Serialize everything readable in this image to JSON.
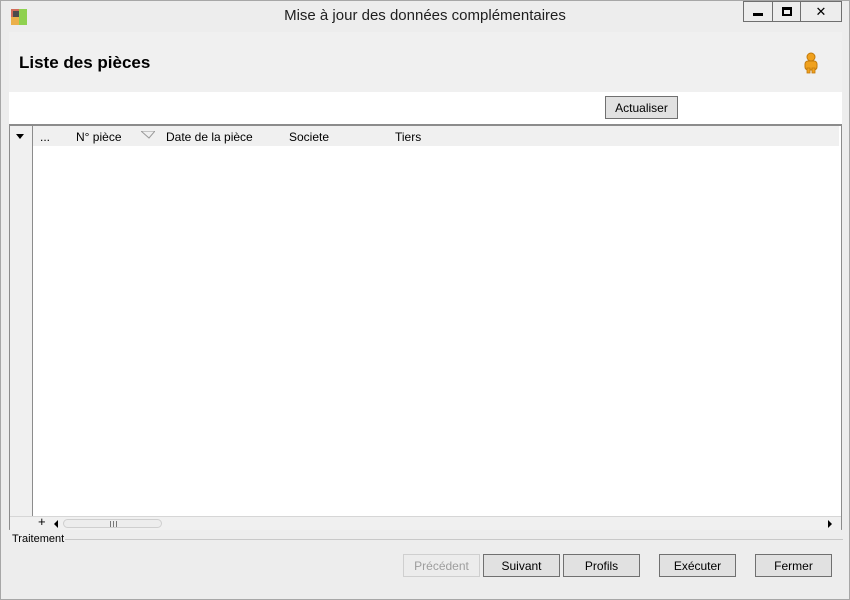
{
  "window": {
    "title": "Mise à jour des données complémentaires",
    "controls": {
      "minimize": "minimize",
      "maximize": "maximize",
      "close": "close"
    }
  },
  "header": {
    "title": "Liste des pièces",
    "user_icon": "user-icon"
  },
  "toolbar": {
    "refresh_label": "Actualiser"
  },
  "grid": {
    "columns": [
      "...",
      "N° pièce",
      "Date de la pièce",
      "Societe",
      "Tiers"
    ],
    "sorted_column": "Date de la pièce",
    "rows": [],
    "footer": {
      "add_symbol": "+",
      "scroll_grip": "|||"
    }
  },
  "section": {
    "label": "Traitement"
  },
  "buttons": {
    "previous": "Précédent",
    "next": "Suivant",
    "profiles": "Profils",
    "execute": "Exécuter",
    "close": "Fermer"
  },
  "colors": {
    "window_bg": "#ededed",
    "header_bg": "#f0f0f0",
    "button_bg": "#e1e1e1",
    "disabled_text": "#9d9d9d"
  }
}
